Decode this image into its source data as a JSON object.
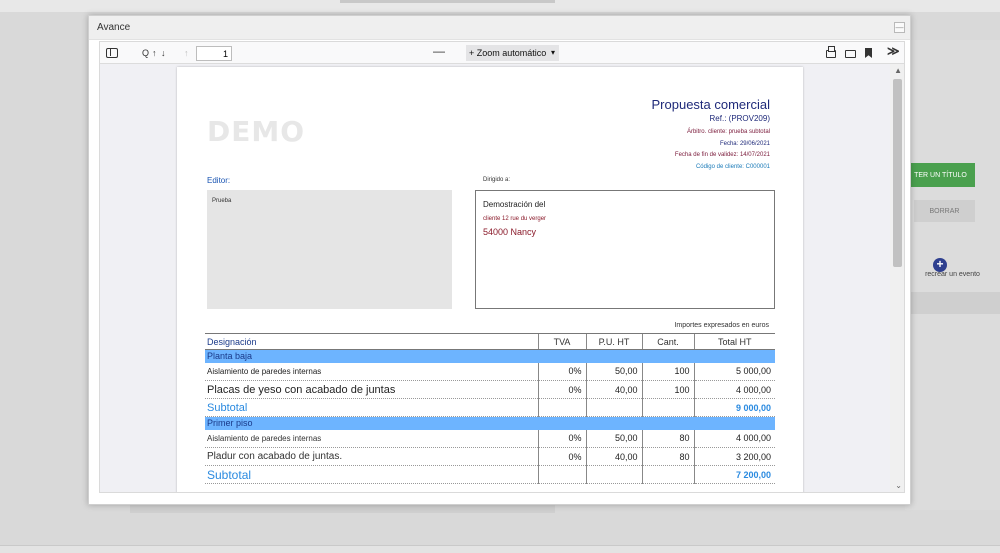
{
  "background": {
    "green_button_label": "TER UN TÍTULO",
    "borrar_label": "BORRAR",
    "add_event_label": "recrear un evento",
    "add_icon": "plus-circle-icon"
  },
  "modal": {
    "title": "Avance",
    "close_icon": "minimize-icon"
  },
  "toolbar": {
    "sidebar_icon": "sidebar-toggle-icon",
    "find_label": "Q",
    "up_label": "↑",
    "down_label": "↓",
    "page_number": "1",
    "zoom_out_label": "—",
    "zoom_label": "+ Zoom automático",
    "print_icon": "print-icon",
    "open_icon": "folder-icon",
    "bookmark_icon": "bookmark-icon",
    "more_label": "≫"
  },
  "document": {
    "watermark": "DEMO",
    "title": "Propuesta comercial",
    "ref": "Ref.: (PROV209)",
    "arbitro": "Árbitro. cliente: prueba subtotal",
    "fecha": "Fecha: 29/06/2021",
    "fecha_validez": "Fecha de fin de validez: 14/07/2021",
    "codigo_cliente": "Código de cliente: C000001",
    "editor_label": "Editor:",
    "editor_name": "Prueba",
    "dirigido_label": "Dirigido a:",
    "client_name": "Demostración del",
    "client_address": "cliente 12 rue du verger",
    "client_city": "54000 Nancy",
    "currency_note": "Importes expresados en euros"
  },
  "table": {
    "headers": [
      "Designación",
      "TVA",
      "P.U. HT",
      "Cant.",
      "Total HT"
    ],
    "rows": [
      {
        "type": "section",
        "label": "Planta baja"
      },
      {
        "type": "item",
        "label": "Aislamiento de paredes internas",
        "tva": "0%",
        "pu": "50,00",
        "qty": "100",
        "total": "5 000,00"
      },
      {
        "type": "item",
        "label": "Placas de yeso con acabado de juntas",
        "tva": "0%",
        "pu": "40,00",
        "qty": "100",
        "total": "4 000,00"
      },
      {
        "type": "subtotal",
        "label": "Subtotal",
        "total": "9 000,00"
      },
      {
        "type": "section",
        "label": "Primer piso"
      },
      {
        "type": "item",
        "label": "Aislamiento de paredes internas",
        "tva": "0%",
        "pu": "50,00",
        "qty": "80",
        "total": "4 000,00"
      },
      {
        "type": "item",
        "label": "Pladur con acabado de juntas.",
        "tva": "0%",
        "pu": "40,00",
        "qty": "80",
        "total": "3 200,00"
      },
      {
        "type": "subtotal",
        "label": "Subtotal",
        "total": "7 200,00"
      }
    ]
  }
}
